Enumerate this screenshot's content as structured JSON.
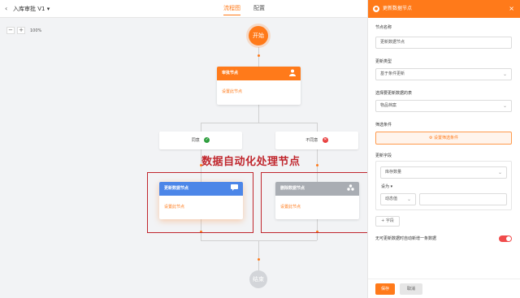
{
  "header": {
    "back_icon": "‹",
    "title": "入库审批 V1 ▾",
    "tabs": [
      {
        "label": "流程图",
        "active": true
      },
      {
        "label": "配置",
        "active": false
      }
    ]
  },
  "zoom": {
    "minus": "−",
    "plus": "+",
    "level": "100%"
  },
  "flow": {
    "start": "开始",
    "end": "结束",
    "approval_node": {
      "title": "审批节点",
      "body": "设置此节点",
      "color": "#ff7a1a"
    },
    "branches": [
      {
        "label": "同意",
        "status": "✓",
        "color": "#2e9e3e"
      },
      {
        "label": "不同意",
        "status": "✕",
        "color": "#e84040"
      }
    ],
    "update_node": {
      "title": "更新数据节点",
      "body": "设置此节点",
      "color": "#4c86e8"
    },
    "delete_node": {
      "title": "删除数据节点",
      "body": "设置此节点",
      "color": "#a9adb3"
    },
    "caption": "数据自动化处理节点"
  },
  "panel": {
    "title": "更新数据节点",
    "close": "×",
    "node_name_label": "节点名称",
    "node_name_value": "更新数据节点",
    "update_type_label": "更新类型",
    "update_type_value": "基于条件更新",
    "table_label": "选择要更新数据的表",
    "table_value": "物品档案",
    "filter_label": "筛选条件",
    "filter_button": "⚙ 设置筛选条件",
    "fields_label": "更新字段",
    "field_value": "库存数量",
    "set_to": "设为 ▾",
    "mode_value": "动态值",
    "add_field": "+ 字段",
    "toggle_label": "无可更新数据时自动新增一条数据",
    "toggle_on": true,
    "save": "保存",
    "cancel": "取消"
  }
}
